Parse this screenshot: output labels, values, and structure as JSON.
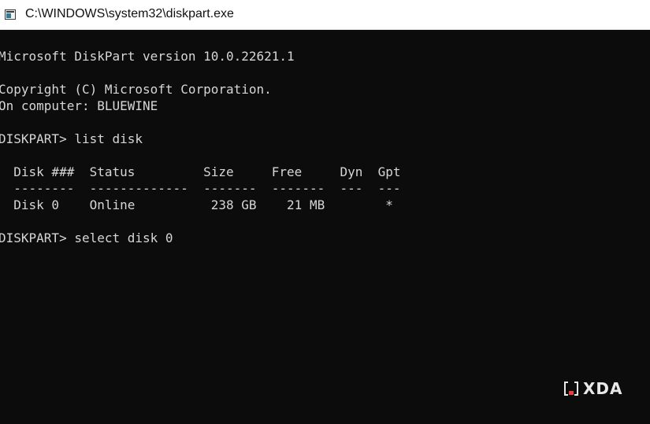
{
  "window": {
    "title": "C:\\WINDOWS\\system32\\diskpart.exe",
    "icon": "console-window-icon"
  },
  "console": {
    "lines": [
      "Microsoft DiskPart version 10.0.22621.1",
      "Copyright (C) Microsoft Corporation.",
      "On computer: BLUEWINE",
      "DISKPART> list disk",
      "  Disk ###  Status         Size     Free     Dyn  Gpt",
      "  --------  -------------  -------  -------  ---  ---",
      "  Disk 0    Online          238 GB    21 MB        *",
      "DISKPART> select disk 0"
    ]
  },
  "watermark": {
    "text": "XDA",
    "accent_color": "#e8413b"
  }
}
